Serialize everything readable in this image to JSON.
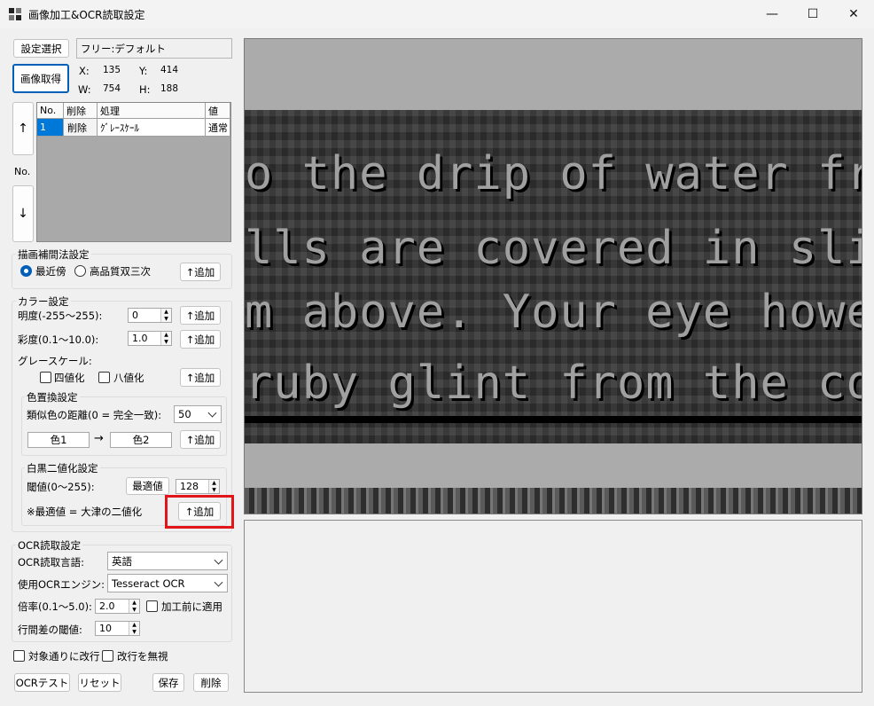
{
  "window": {
    "title": "画像加工&OCR読取設定",
    "controls": [
      "—",
      "☐",
      "✕"
    ]
  },
  "settings": {
    "select_button": "設定選択",
    "current_profile": "フリー:デフォルト",
    "capture_button": "画像取得",
    "x_label": "X:",
    "x_value": "135",
    "y_label": "Y:",
    "y_value": "414",
    "w_label": "W:",
    "w_value": "754",
    "h_label": "H:",
    "h_value": "188"
  },
  "order": {
    "up": "↑",
    "no_label": "No.",
    "down": "↓"
  },
  "table": {
    "headers": [
      "No.",
      "削除",
      "処理",
      "値"
    ],
    "rows": [
      {
        "no": "1",
        "delete": "削除",
        "process": "ｸﾞﾚｰｽｹｰﾙ",
        "value": "通常"
      }
    ]
  },
  "interp": {
    "title": "描画補間法設定",
    "opt1": "最近傍",
    "opt2": "高品質双三次",
    "selected": "最近傍",
    "add": "↑追加"
  },
  "color": {
    "title": "カラー設定",
    "brightness_label": "明度(-255～255):",
    "brightness_value": "0",
    "saturation_label": "彩度(0.1～10.0):",
    "saturation_value": "1.0",
    "gray_label": "グレースケール:",
    "quad_label": "四値化",
    "oct_label": "八値化",
    "add": "↑追加"
  },
  "replace": {
    "title": "色置換設定",
    "distance_label": "類似色の距離(0 = 完全一致):",
    "distance_value": "50",
    "color1": "色1",
    "arrow": "→",
    "color2": "色2",
    "add": "↑追加"
  },
  "binary": {
    "title": "白黒二値化設定",
    "threshold_label": "閾値(0～255):",
    "optimal_button": "最適値",
    "threshold_value": "128",
    "note": "※最適値 = 大津の二値化",
    "add": "↑追加"
  },
  "ocr": {
    "title": "OCR読取設定",
    "lang_label": "OCR読取言語:",
    "lang_value": "英語",
    "engine_label": "使用OCRエンジン:",
    "engine_value": "Tesseract OCR",
    "scale_label": "倍率(0.1～5.0):",
    "scale_value": "2.0",
    "apply_before_label": "加工前に適用",
    "line_gap_label": "行間差の閾値:",
    "line_gap_value": "10"
  },
  "options": {
    "newline_target": "対象通りに改行",
    "ignore_newline": "改行を無視"
  },
  "footer": {
    "ocr_test": "OCRテスト",
    "reset": "リセット",
    "save": "保存",
    "delete": "削除"
  },
  "preview": {
    "lines": [
      "o the drip of water from so",
      "lls are covered in slime, as a",
      "m above. Your eye however i",
      " ruby glint from the corner"
    ]
  },
  "colors": {
    "accent": "#005fb8",
    "highlight": "#e0161a",
    "text_pixels": "#a0a0a0"
  }
}
